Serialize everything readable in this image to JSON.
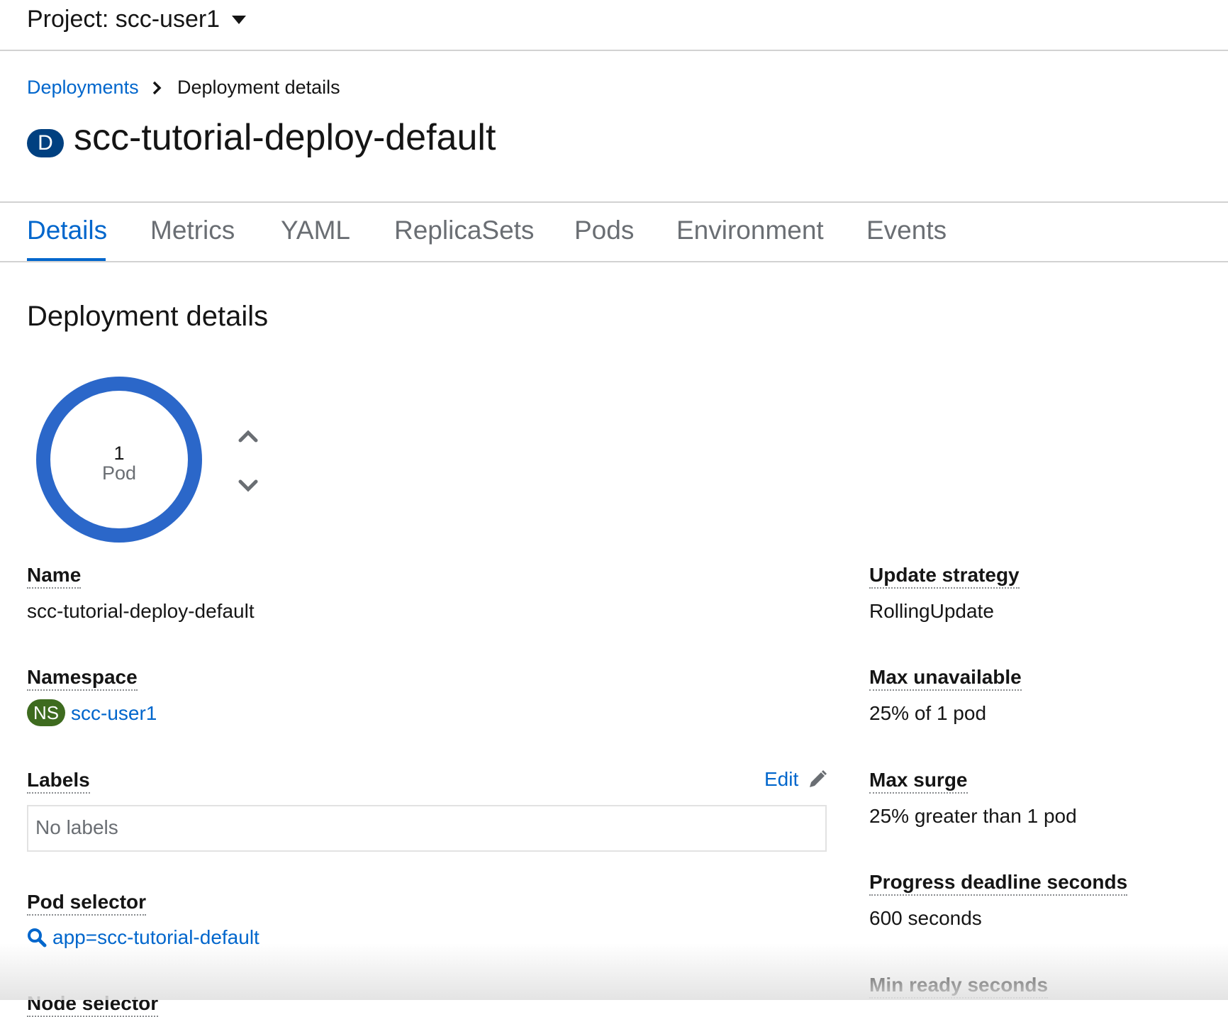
{
  "project": {
    "label": "Project: scc-user1"
  },
  "breadcrumb": {
    "parent": "Deployments",
    "current": "Deployment details"
  },
  "resource": {
    "badge": "D",
    "title": "scc-tutorial-deploy-default"
  },
  "tabs": [
    {
      "label": "Details",
      "active": true
    },
    {
      "label": "Metrics"
    },
    {
      "label": "YAML"
    },
    {
      "label": "ReplicaSets"
    },
    {
      "label": "Pods"
    },
    {
      "label": "Environment"
    },
    {
      "label": "Events"
    }
  ],
  "section": {
    "title": "Deployment details"
  },
  "pods": {
    "count": "1",
    "unit": "Pod",
    "ring_color": "#2b67c9"
  },
  "details_left": {
    "name": {
      "label": "Name",
      "value": "scc-tutorial-deploy-default"
    },
    "namespace": {
      "label": "Namespace",
      "badge": "NS",
      "value": "scc-user1"
    },
    "labels": {
      "label": "Labels",
      "edit": "Edit",
      "empty": "No labels"
    },
    "pod_selector": {
      "label": "Pod selector",
      "value": "app=scc-tutorial-default"
    },
    "node_selector": {
      "label": "Node selector"
    }
  },
  "details_right": {
    "update_strategy": {
      "label": "Update strategy",
      "value": "RollingUpdate"
    },
    "max_unavailable": {
      "label": "Max unavailable",
      "value": "25% of 1 pod"
    },
    "max_surge": {
      "label": "Max surge",
      "value": "25% greater than 1 pod"
    },
    "progress_deadline": {
      "label": "Progress deadline seconds",
      "value": "600 seconds"
    },
    "min_ready": {
      "label": "Min ready seconds"
    }
  },
  "colors": {
    "link": "#0066cc",
    "badge_deployment": "#004080",
    "badge_namespace": "#3e6b1f"
  }
}
